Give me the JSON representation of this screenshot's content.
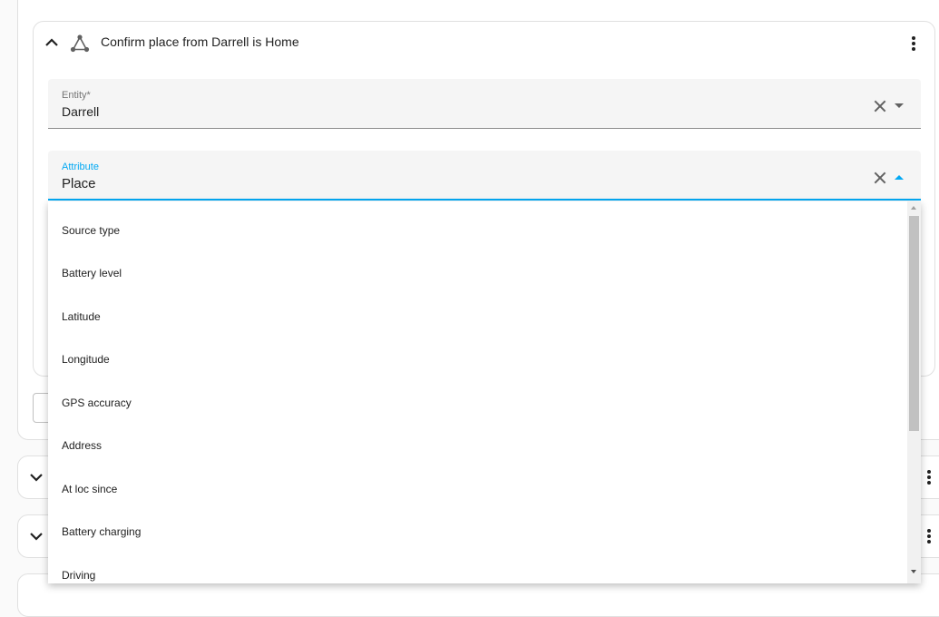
{
  "action": {
    "title": "Confirm place from Darrell is Home",
    "icon": "graph-icon"
  },
  "entity_field": {
    "label": "Entity*",
    "value": "Darrell"
  },
  "attribute_field": {
    "label": "Attribute",
    "value": "Place"
  },
  "options": [
    "Source type",
    "Battery level",
    "Latitude",
    "Longitude",
    "GPS accuracy",
    "Address",
    "At loc since",
    "Battery charging",
    "Driving"
  ],
  "colors": {
    "accent": "#03a9f4",
    "field_bg": "#f5f5f5",
    "card_border": "#e0e0e0"
  }
}
